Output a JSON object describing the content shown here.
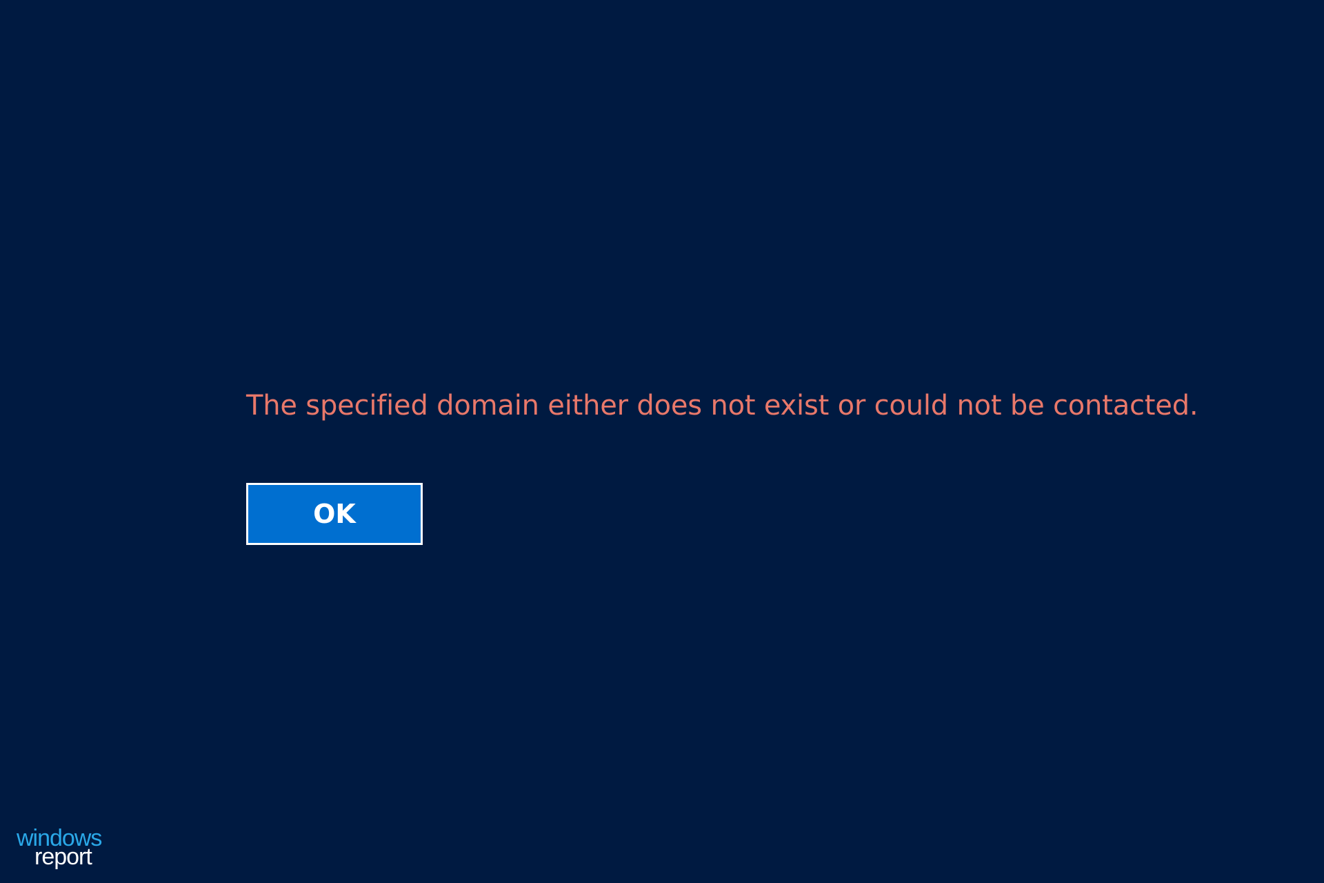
{
  "dialog": {
    "message": "The specified domain either does not exist or could not be contacted.",
    "ok_label": "OK"
  },
  "watermark": {
    "line1": "windows",
    "line2": "report"
  },
  "colors": {
    "background": "#001a41",
    "message_text": "#e8786a",
    "button_fill": "#006fd0",
    "button_border": "#ffffff",
    "logo_line1": "#2aa8e8",
    "logo_line2": "#ffffff"
  }
}
